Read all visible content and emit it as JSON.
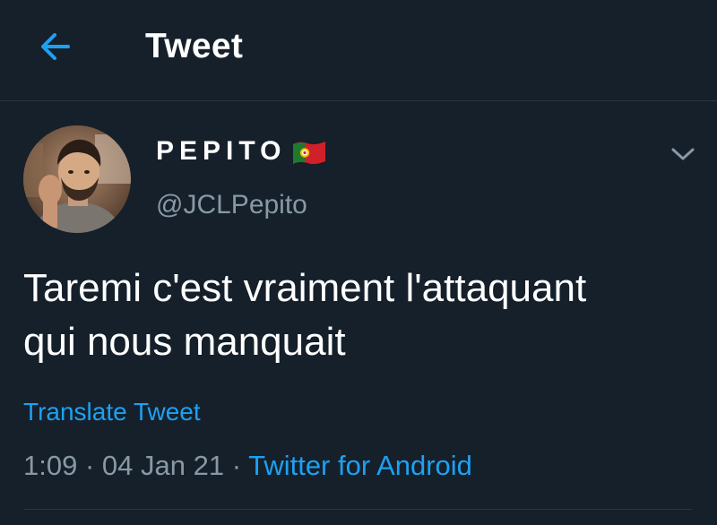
{
  "header": {
    "title": "Tweet",
    "back_icon": "arrow-left-icon",
    "accent_color": "#1da1f2",
    "background_color": "#15202b"
  },
  "author": {
    "display_name": "PEPITO",
    "flag_icon": "portugal-flag-icon",
    "handle": "@JCLPepito",
    "more_icon": "chevron-down-icon"
  },
  "tweet": {
    "text_line1": "Taremi c'est vraiment l'attaquant",
    "text_line2": "qui nous manquait",
    "translate_label": "Translate Tweet",
    "time": "1:09",
    "date": "04 Jan 21",
    "separator": "·",
    "source": "Twitter for Android"
  }
}
